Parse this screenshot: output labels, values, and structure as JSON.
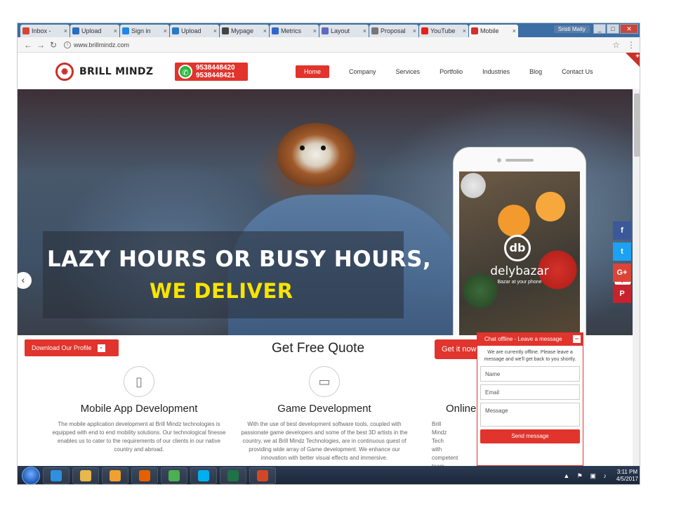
{
  "browser": {
    "tabs": [
      {
        "label": "Inbox -",
        "color": "#d44638"
      },
      {
        "label": "Upload",
        "color": "#2a6ebb"
      },
      {
        "label": "Sign in",
        "color": "#1e88e5"
      },
      {
        "label": "Upload",
        "color": "#2a7ac2"
      },
      {
        "label": "Mypage",
        "color": "#444444"
      },
      {
        "label": "Metrics",
        "color": "#3366cc"
      },
      {
        "label": "Layout",
        "color": "#5c6bc0"
      },
      {
        "label": "Proposal",
        "color": "#777777"
      },
      {
        "label": "YouTube",
        "color": "#e62117"
      },
      {
        "label": "Mobile",
        "color": "#d32f2f"
      }
    ],
    "user": "Sristi Maity",
    "url": "www.brillmindz.com"
  },
  "header": {
    "brand": "BRILL MINDZ",
    "phones": [
      "9538448420",
      "9538448421"
    ],
    "nav": [
      "Home",
      "Company",
      "Services",
      "Portfolio",
      "Industries",
      "Blog",
      "Contact Us"
    ],
    "active_nav": "Home"
  },
  "hero": {
    "line1": "LAZY HOURS OR BUSY HOURS,",
    "line2": "WE DELIVER",
    "app_badge": "db",
    "app_name": "delybazar",
    "app_tagline": "Bazar at your phone"
  },
  "social": [
    "f",
    "t",
    "G+",
    "P"
  ],
  "content": {
    "download_label": "Download Our Profile",
    "pdf_label": "PDF",
    "quote_title": "Get Free Quote",
    "get_now": "Get it now",
    "services": [
      {
        "title": "Mobile App Development",
        "desc": "The mobile application development at Brill Mindz technologies is equipped with end to end mobility solutions. Our technological finesse enables us to cater to the requirements of our clients in our native country and abroad."
      },
      {
        "title": "Game Development",
        "desc": "With the use of best development software tools, coupled with passionate game developers and some of the best 3D artists in the country, we at Brill Mindz Technologies, are in continuous quest of providing wide array of Game development. We enhance our innovation with better visual effects and immersive."
      },
      {
        "title": "Online",
        "desc": "Brill Mindz Tech with competent team of Search minute detail marketing ini Brill"
      }
    ]
  },
  "chat": {
    "header": "Chat offline - Leave a message",
    "message": "We are currently offline. Please leave a message and we'll get back to you shortly.",
    "name_placeholder": "Name",
    "email_placeholder": "Email",
    "message_placeholder": "Message",
    "send": "Send message"
  },
  "taskbar": {
    "apps": [
      {
        "name": "ie-icon",
        "color": "#2f8fe0"
      },
      {
        "name": "folder-icon",
        "color": "#e8b84a"
      },
      {
        "name": "media-player-icon",
        "color": "#f0a030"
      },
      {
        "name": "firefox-icon",
        "color": "#e66000"
      },
      {
        "name": "chrome-icon",
        "color": "#4caf50"
      },
      {
        "name": "skype-icon",
        "color": "#00aff0"
      },
      {
        "name": "excel-icon",
        "color": "#1f7244"
      },
      {
        "name": "powerpoint-icon",
        "color": "#d24726"
      }
    ],
    "time": "3:11 PM",
    "date": "4/5/2017"
  }
}
